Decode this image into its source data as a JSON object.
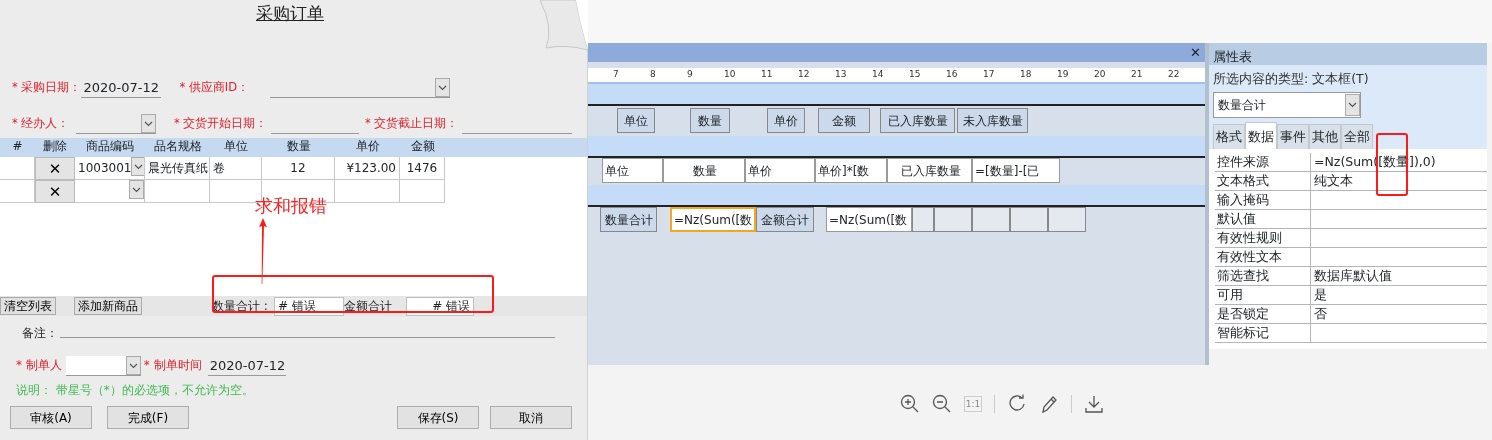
{
  "form": {
    "title": "采购订单",
    "field_rows": [
      [
        {
          "label": "* 采购日期：",
          "required": true,
          "kind": "line",
          "value": "2020-07-12"
        },
        {
          "label": "* 供应商ID：",
          "required": true,
          "kind": "combo"
        }
      ],
      [
        {
          "label": "* 经办人：",
          "required": true,
          "kind": "combo"
        },
        {
          "label": "* 交货开始日期：",
          "required": true,
          "kind": "line"
        },
        {
          "label": "* 交货截止日期：",
          "required": true,
          "kind": "line"
        }
      ]
    ],
    "grid": {
      "columns": [
        "#",
        "删除",
        "商品编码",
        "品名规格",
        "单位",
        "数量",
        "单价",
        "金额"
      ],
      "rows": [
        {
          "cells": [
            "",
            "✕",
            "1003001",
            "晨光传真纸",
            "卷",
            "12",
            "¥123.00",
            "1476"
          ]
        },
        {
          "cells": [
            "",
            "✕",
            "",
            "",
            "",
            "",
            "",
            ""
          ]
        }
      ]
    },
    "list_buttons": [
      "清空列表",
      "添加新商品"
    ],
    "totals": [
      {
        "label": "数量合计 :",
        "value": "# 错误"
      },
      {
        "label": "金额合计",
        "value": "# 错误"
      }
    ],
    "remark_label": "备注：",
    "maker": {
      "label": "* 制单人",
      "time_label": "* 制单时间",
      "time_value": "2020-07-12"
    },
    "note": "说明： 带星号（*）的必选项，不允许为空。",
    "buttons": [
      "审核(A)",
      "完成(F)",
      "保存(S)",
      "取消"
    ]
  },
  "annotation": {
    "text": "求和报错"
  },
  "design_view": {
    "close": "✕",
    "ruler": [
      "7",
      "8",
      "9",
      "10",
      "11",
      "12",
      "13",
      "14",
      "15",
      "16",
      "17",
      "18",
      "19",
      "20",
      "21",
      "22"
    ],
    "header_labels": [
      "单位",
      "数量",
      "单价",
      "金额",
      "已入库数量",
      "未入库数量"
    ],
    "detail_cells": [
      "单位",
      "数量",
      "单价",
      "单价]*[数",
      "已入库数量",
      "=[数量]-[已"
    ],
    "footer_cells": [
      {
        "text": "数量合计",
        "kind": "label",
        "selected": false
      },
      {
        "text": "=Nz(Sum([数",
        "kind": "textbox",
        "selected": true
      },
      {
        "text": "金额合计",
        "kind": "label",
        "selected": false
      },
      {
        "text": "=Nz(Sum([数",
        "kind": "textbox",
        "selected": false
      }
    ]
  },
  "property_sheet": {
    "title": "属性表",
    "type_label": "所选内容的类型: 文本框(T)",
    "selector": "数量合计",
    "tabs": [
      {
        "label": "格式",
        "selected": false
      },
      {
        "label": "数据",
        "selected": true
      },
      {
        "label": "事件",
        "selected": false
      },
      {
        "label": "其他",
        "selected": false
      },
      {
        "label": "全部",
        "selected": false
      }
    ],
    "rows": [
      {
        "name": "控件来源",
        "value": "=Nz(Sum([数量]),0)"
      },
      {
        "name": "文本格式",
        "value": "纯文本"
      },
      {
        "name": "输入掩码",
        "value": ""
      },
      {
        "name": "默认值",
        "value": ""
      },
      {
        "name": "有效性规则",
        "value": ""
      },
      {
        "name": "有效性文本",
        "value": ""
      },
      {
        "name": "筛选查找",
        "value": "数据库默认值"
      },
      {
        "name": "可用",
        "value": "是"
      },
      {
        "name": "是否锁定",
        "value": "否"
      },
      {
        "name": "智能标记",
        "value": ""
      }
    ]
  },
  "viewer_toolbar": {
    "actual_size": {
      "label": "1:1",
      "disabled": true
    }
  }
}
